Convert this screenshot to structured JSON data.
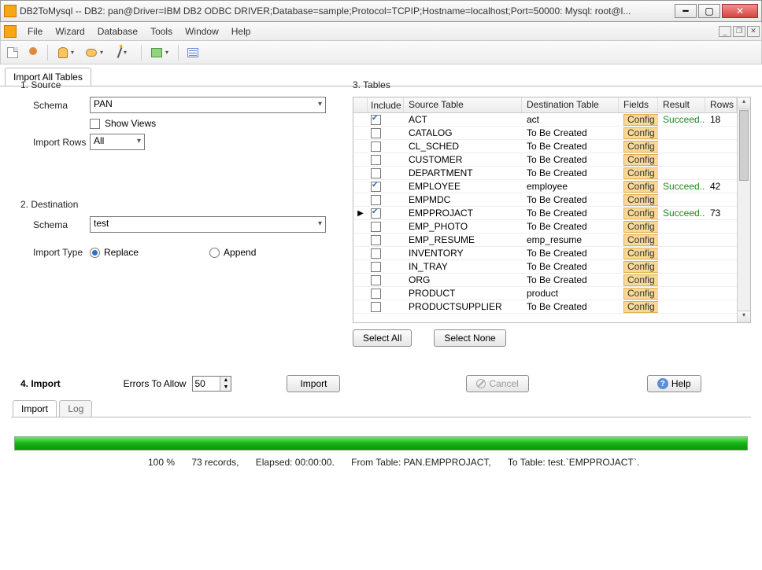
{
  "window": {
    "title": "DB2ToMysql -- DB2: pan@Driver=IBM DB2 ODBC DRIVER;Database=sample;Protocol=TCPIP;Hostname=localhost;Port=50000: Mysql: root@l..."
  },
  "menu": {
    "items": [
      "File",
      "Wizard",
      "Database",
      "Tools",
      "Window",
      "Help"
    ]
  },
  "main_tab": "Import All Tables",
  "source": {
    "heading": "1. Source",
    "schema_label": "Schema",
    "schema_value": "PAN",
    "show_views_label": "Show Views",
    "show_views_checked": false,
    "import_rows_label": "Import Rows",
    "import_rows_value": "All"
  },
  "destination": {
    "heading": "2. Destination",
    "schema_label": "Schema",
    "schema_value": "test",
    "import_type_label": "Import Type",
    "opts": {
      "replace": "Replace",
      "append": "Append"
    },
    "selected": "replace"
  },
  "tables": {
    "heading": "3. Tables",
    "headers": {
      "include": "Include",
      "source": "Source Table",
      "dest": "Destination Table",
      "fields": "Fields",
      "result": "Result",
      "rows": "Rows"
    },
    "config_label": "Config",
    "select_all": "Select All",
    "select_none": "Select None",
    "rows": [
      {
        "include": true,
        "source": "ACT",
        "dest": "act",
        "result": "Succeed...",
        "rows": "18",
        "ptr": false
      },
      {
        "include": false,
        "source": "CATALOG",
        "dest": "To Be Created",
        "result": "",
        "rows": "",
        "ptr": false
      },
      {
        "include": false,
        "source": "CL_SCHED",
        "dest": "To Be Created",
        "result": "",
        "rows": "",
        "ptr": false
      },
      {
        "include": false,
        "source": "CUSTOMER",
        "dest": "To Be Created",
        "result": "",
        "rows": "",
        "ptr": false
      },
      {
        "include": false,
        "source": "DEPARTMENT",
        "dest": "To Be Created",
        "result": "",
        "rows": "",
        "ptr": false
      },
      {
        "include": true,
        "source": "EMPLOYEE",
        "dest": "employee",
        "result": "Succeed...",
        "rows": "42",
        "ptr": false
      },
      {
        "include": false,
        "source": "EMPMDC",
        "dest": "To Be Created",
        "result": "",
        "rows": "",
        "ptr": false
      },
      {
        "include": true,
        "source": "EMPPROJACT",
        "dest": "To Be Created",
        "result": "Succeed...",
        "rows": "73",
        "ptr": true
      },
      {
        "include": false,
        "source": "EMP_PHOTO",
        "dest": "To Be Created",
        "result": "",
        "rows": "",
        "ptr": false
      },
      {
        "include": false,
        "source": "EMP_RESUME",
        "dest": "emp_resume",
        "result": "",
        "rows": "",
        "ptr": false
      },
      {
        "include": false,
        "source": "INVENTORY",
        "dest": "To Be Created",
        "result": "",
        "rows": "",
        "ptr": false
      },
      {
        "include": false,
        "source": "IN_TRAY",
        "dest": "To Be Created",
        "result": "",
        "rows": "",
        "ptr": false
      },
      {
        "include": false,
        "source": "ORG",
        "dest": "To Be Created",
        "result": "",
        "rows": "",
        "ptr": false
      },
      {
        "include": false,
        "source": "PRODUCT",
        "dest": "product",
        "result": "",
        "rows": "",
        "ptr": false
      },
      {
        "include": false,
        "source": "PRODUCTSUPPLIER",
        "dest": "To Be Created",
        "result": "",
        "rows": "",
        "ptr": false
      }
    ]
  },
  "import": {
    "heading": "4.  Import",
    "errors_label": "Errors To Allow",
    "errors_value": "50",
    "import_btn": "Import",
    "cancel_btn": "Cancel",
    "help_btn": "Help"
  },
  "log_tabs": {
    "import": "Import",
    "log": "Log"
  },
  "progress": {
    "percent": "100 %",
    "records": "73 records,",
    "elapsed": "Elapsed: 00:00:00.",
    "from": "From Table: PAN.EMPPROJACT,",
    "to": "To Table: test.`EMPPROJACT`."
  }
}
